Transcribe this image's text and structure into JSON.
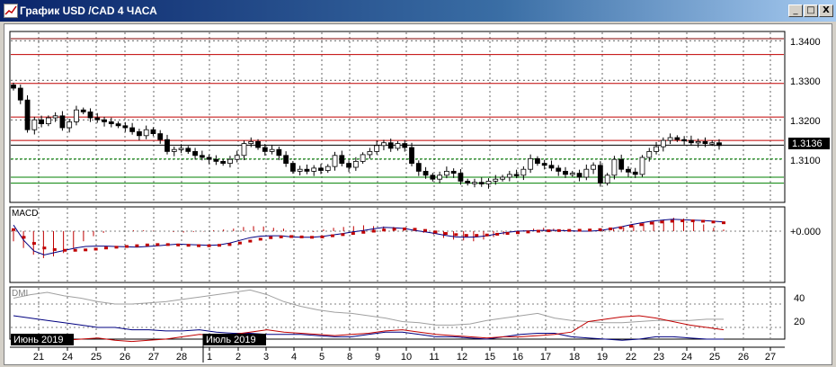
{
  "window": {
    "title": "График USD /CAD  4 ЧАСА",
    "min_glyph": "_",
    "max_glyph": "□",
    "close_glyph": "X",
    "icon": "chart-window-icon"
  },
  "price_panel": {
    "y_ticks": [
      "1.3400",
      "1.3300",
      "1.3200",
      "1.3100"
    ],
    "current_price": "1.3136",
    "levels": [
      1.3405,
      1.3365,
      1.3292,
      1.3207,
      1.3148,
      1.3136,
      1.3101,
      1.3055,
      1.304
    ]
  },
  "macd_panel": {
    "label": "MACD",
    "zero_label": "+0.000"
  },
  "dmi_panel": {
    "label": "DMI",
    "y_ticks": [
      "40",
      "20"
    ]
  },
  "x_axis": {
    "day_labels": [
      "21",
      "24",
      "25",
      "26",
      "27",
      "28",
      "1",
      "2",
      "3",
      "4",
      "5",
      "8",
      "9",
      "10",
      "11",
      "12",
      "15",
      "16",
      "17",
      "18",
      "19",
      "22",
      "23",
      "24",
      "25",
      "26",
      "27"
    ],
    "month_labels": [
      "Июнь 2019",
      "Июль 2019"
    ]
  },
  "chart_data": {
    "type": "candlestick",
    "title": "График USD /CAD  4 ЧАСА",
    "categories": [
      "21",
      "24",
      "25",
      "26",
      "27",
      "28",
      "1",
      "2",
      "3",
      "4",
      "5",
      "8",
      "9",
      "10",
      "11",
      "12",
      "15",
      "16",
      "17",
      "18",
      "19",
      "22",
      "23",
      "24",
      "25",
      "26",
      "27"
    ],
    "y_ticks": [
      1.34,
      1.33,
      1.32,
      1.31
    ],
    "ylim": [
      1.302,
      1.344
    ],
    "current_price": 1.3136,
    "horizontal_levels": [
      1.3405,
      1.3365,
      1.3292,
      1.3207,
      1.3148,
      1.3136,
      1.3101,
      1.3055,
      1.304
    ],
    "close_series": [
      1.328,
      1.325,
      1.3175,
      1.32,
      1.319,
      1.3205,
      1.321,
      1.318,
      1.3195,
      1.3225,
      1.322,
      1.3205,
      1.32,
      1.3195,
      1.319,
      1.3185,
      1.318,
      1.317,
      1.316,
      1.3175,
      1.3165,
      1.315,
      1.312,
      1.3125,
      1.3128,
      1.312,
      1.311,
      1.3105,
      1.31,
      1.3095,
      1.309,
      1.31,
      1.311,
      1.314,
      1.3145,
      1.313,
      1.312,
      1.3125,
      1.311,
      1.309,
      1.307,
      1.3075,
      1.307,
      1.3078,
      1.3072,
      1.3082,
      1.311,
      1.309,
      1.308,
      1.3095,
      1.3112,
      1.312,
      1.3135,
      1.3142,
      1.3128,
      1.314,
      1.313,
      1.309,
      1.307,
      1.306,
      1.305,
      1.306,
      1.307,
      1.3065,
      1.3045,
      1.304,
      1.3042,
      1.3038,
      1.3045,
      1.305,
      1.3055,
      1.3062,
      1.306,
      1.3075,
      1.3102,
      1.309,
      1.3085,
      1.3078,
      1.307,
      1.3062,
      1.3065,
      1.3055,
      1.3075,
      1.3085,
      1.304,
      1.306,
      1.31,
      1.3075,
      1.3068,
      1.3062,
      1.3105,
      1.312,
      1.3132,
      1.3148,
      1.3155,
      1.315,
      1.3148,
      1.3142,
      1.3145,
      1.314,
      1.3142,
      1.3135
    ],
    "macd": {
      "zero_label": "+0.000",
      "histogram": [
        -0.6,
        -1.0,
        -1.4,
        -1.6,
        -1.5,
        -1.3,
        -1.0,
        -0.6,
        -0.3,
        -0.1,
        0.0,
        0.0,
        0.05,
        0.05,
        0.03,
        0.0,
        -0.05,
        -0.08,
        -0.05,
        -0.02,
        0.05,
        0.1,
        0.15,
        0.25,
        0.3,
        0.28,
        0.2,
        0.15,
        0.05,
        0.0,
        -0.05,
        0.1,
        0.2,
        0.25,
        0.3,
        0.35,
        0.3,
        0.28,
        0.25,
        0.15,
        0.05,
        -0.1,
        -0.2,
        -0.4,
        -0.5,
        -0.55,
        -0.6,
        -0.5,
        -0.35,
        -0.2,
        -0.05,
        0.05,
        0.15,
        0.2,
        0.15,
        0.1,
        0.05,
        0.02,
        0.0,
        0.05,
        0.15,
        0.25,
        0.35,
        0.5,
        0.6,
        0.7,
        0.8,
        0.75,
        0.6,
        0.4,
        0.2,
        0.1
      ],
      "signal": [
        0.2,
        -0.8,
        -1.6,
        -2.2,
        -2.4,
        -2.5,
        -2.5,
        -2.45,
        -2.35,
        -2.2,
        -2.1,
        -2.0,
        -1.9,
        -1.8,
        -1.75,
        -1.75,
        -1.8,
        -1.85,
        -1.9,
        -1.9,
        -1.85,
        -1.75,
        -1.55,
        -1.3,
        -1.05,
        -0.85,
        -0.75,
        -0.7,
        -0.75,
        -0.8,
        -0.75,
        -0.6,
        -0.45,
        -0.3,
        -0.15,
        0.0,
        0.15,
        0.25,
        0.3,
        0.25,
        0.1,
        -0.1,
        -0.3,
        -0.45,
        -0.55,
        -0.55,
        -0.5,
        -0.4,
        -0.3,
        -0.2,
        -0.1,
        0.0,
        0.05,
        0.08,
        0.1,
        0.12,
        0.15,
        0.2,
        0.3,
        0.45,
        0.65,
        0.85,
        1.05,
        1.2,
        1.3,
        1.35,
        1.35,
        1.3,
        1.2,
        1.1
      ],
      "main": [
        0.8,
        -1.2,
        -2.6,
        -3.1,
        -2.8,
        -2.5,
        -2.2,
        -2.0,
        -1.95,
        -1.95,
        -2.0,
        -2.05,
        -2.1,
        -2.0,
        -1.9,
        -1.8,
        -1.7,
        -1.75,
        -1.8,
        -1.85,
        -1.8,
        -1.55,
        -1.2,
        -0.85,
        -0.65,
        -0.6,
        -0.6,
        -0.75,
        -0.8,
        -0.8,
        -0.7,
        -0.5,
        -0.3,
        -0.1,
        0.1,
        0.3,
        0.5,
        0.45,
        0.35,
        0.1,
        -0.1,
        -0.3,
        -0.55,
        -0.75,
        -0.8,
        -0.75,
        -0.6,
        -0.35,
        -0.15,
        0.0,
        0.05,
        0.1,
        0.12,
        0.1,
        0.05,
        0.0,
        0.0,
        0.1,
        0.3,
        0.55,
        0.85,
        1.1,
        1.3,
        1.45,
        1.55,
        1.5,
        1.45,
        1.4,
        1.3,
        1.2
      ]
    },
    "dmi": {
      "y_ticks": [
        40,
        20
      ],
      "series": [
        {
          "values": [
            45,
            48,
            50,
            47,
            45,
            42,
            40,
            40,
            41,
            42,
            44,
            46,
            48,
            50,
            52,
            48,
            42,
            38,
            35,
            33,
            32,
            30,
            28,
            25,
            24,
            22,
            22,
            23,
            26,
            28,
            30,
            32,
            28,
            26,
            25,
            24,
            24,
            25,
            26,
            26,
            26,
            27,
            27
          ]
        },
        {
          "values": [
            30,
            28,
            26,
            24,
            22,
            20,
            20,
            18,
            18,
            17,
            17,
            18,
            16,
            15,
            15,
            14,
            14,
            14,
            13,
            12,
            12,
            14,
            16,
            16,
            14,
            12,
            12,
            11,
            10,
            12,
            14,
            15,
            15,
            12,
            11,
            10,
            9,
            10,
            12,
            12,
            11,
            10,
            10
          ]
        },
        {
          "values": [
            10,
            10,
            9,
            9,
            10,
            11,
            9,
            8,
            9,
            10,
            12,
            14,
            13,
            14,
            16,
            18,
            16,
            15,
            14,
            13,
            14,
            15,
            17,
            18,
            16,
            14,
            13,
            12,
            11,
            12,
            12,
            13,
            14,
            16,
            25,
            27,
            29,
            30,
            28,
            25,
            22,
            20,
            18
          ]
        }
      ]
    }
  }
}
